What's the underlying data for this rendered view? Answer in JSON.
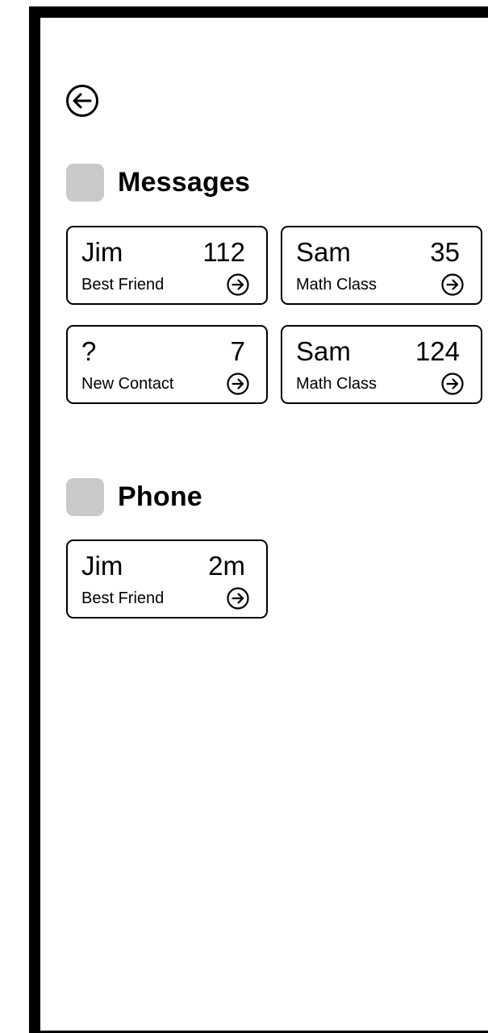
{
  "back": {
    "icon": "arrow-left-circle-icon"
  },
  "messages": {
    "title": "Messages",
    "cards": [
      {
        "name": "Jim",
        "count": "112",
        "subtitle": "Best Friend",
        "icon": "arrow-right-circle-icon"
      },
      {
        "name": "Sam",
        "count": "35",
        "subtitle": "Math Class",
        "icon": "arrow-right-circle-icon"
      },
      {
        "name": "?",
        "count": "7",
        "subtitle": "New Contact",
        "icon": "arrow-right-circle-icon"
      },
      {
        "name": "Sam",
        "count": "124",
        "subtitle": "Math Class",
        "icon": "arrow-right-circle-icon"
      }
    ]
  },
  "phone": {
    "title": "Phone",
    "cards": [
      {
        "name": "Jim",
        "count": "2m",
        "subtitle": "Best Friend",
        "icon": "arrow-right-circle-icon"
      }
    ]
  },
  "colors": {
    "frame": "#000000",
    "section_icon": "#c9c9c9",
    "background": "#ffffff"
  }
}
